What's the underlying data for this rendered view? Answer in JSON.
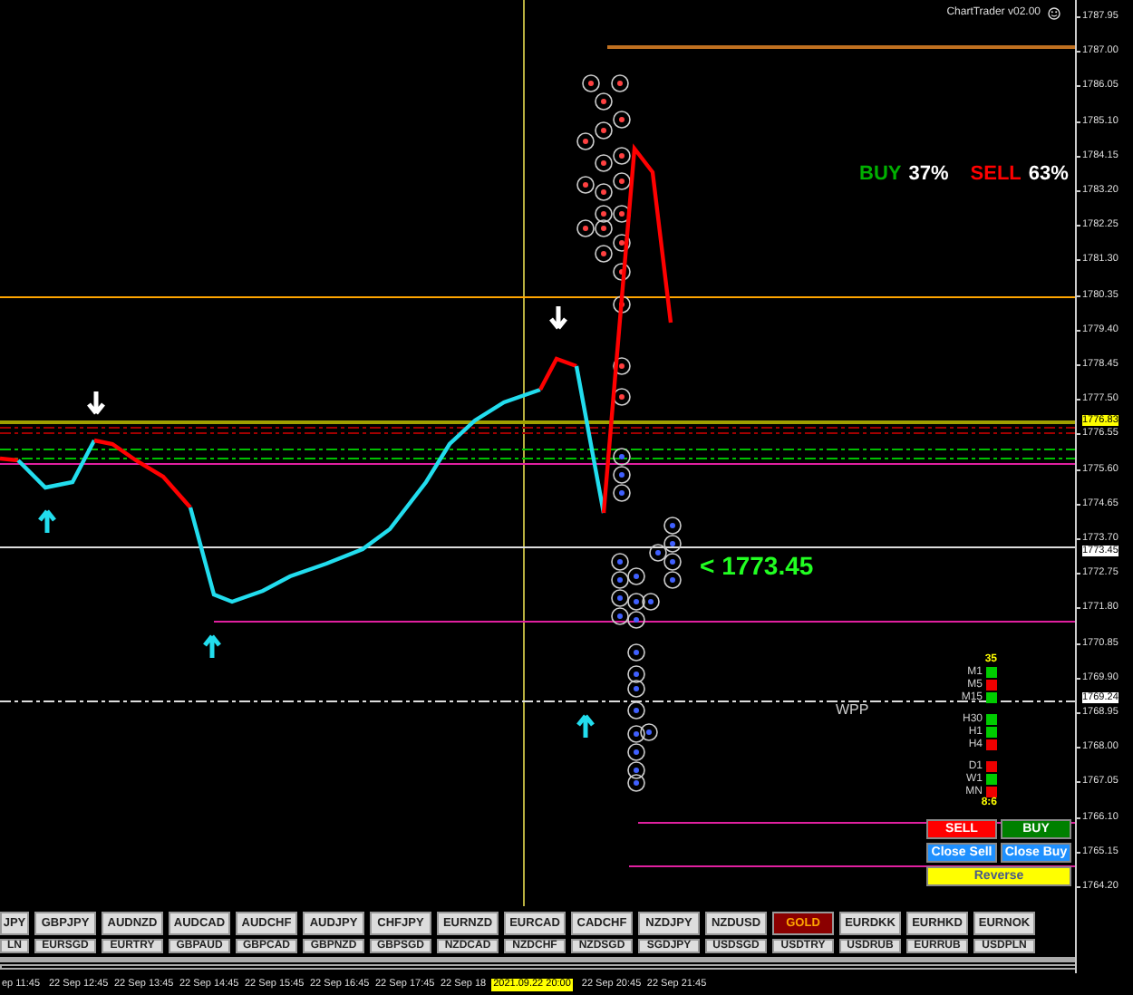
{
  "indicator_title": "ChartTrader v02.00",
  "sentiment": {
    "buy_label": "BUY",
    "buy_percent": "37%",
    "sell_label": "SELL",
    "sell_percent": "63%"
  },
  "price_marker": "< 1773.45",
  "pivot_label": "WPP",
  "timeframes": {
    "top_value": "35",
    "groups": [
      [
        {
          "label": "M1",
          "color": "#00cc00"
        },
        {
          "label": "M5",
          "color": "#ee0000"
        },
        {
          "label": "M15",
          "color": "#00cc00"
        }
      ],
      [
        {
          "label": "H30",
          "color": "#00cc00"
        },
        {
          "label": "H1",
          "color": "#00cc00"
        },
        {
          "label": "H4",
          "color": "#ee0000"
        }
      ],
      [
        {
          "label": "D1",
          "color": "#ee0000"
        },
        {
          "label": "W1",
          "color": "#00cc00"
        },
        {
          "label": "MN",
          "color": "#ee0000"
        }
      ]
    ],
    "bottom_value": "8:6"
  },
  "trade_buttons": [
    {
      "label": "SELL",
      "kind": "sell"
    },
    {
      "label": "BUY",
      "kind": "buy"
    },
    {
      "label": "Close Sell",
      "kind": "close"
    },
    {
      "label": "Close Buy",
      "kind": "close"
    },
    {
      "label": "Reverse",
      "kind": "reverse"
    }
  ],
  "symbol_rows": [
    [
      {
        "label": "JPY",
        "selected": false
      },
      {
        "label": "GBPJPY",
        "selected": false
      },
      {
        "label": "AUDNZD",
        "selected": false
      },
      {
        "label": "AUDCAD",
        "selected": false
      },
      {
        "label": "AUDCHF",
        "selected": false
      },
      {
        "label": "AUDJPY",
        "selected": false
      },
      {
        "label": "CHFJPY",
        "selected": false
      },
      {
        "label": "EURNZD",
        "selected": false
      },
      {
        "label": "EURCAD",
        "selected": false
      },
      {
        "label": "CADCHF",
        "selected": false
      },
      {
        "label": "NZDJPY",
        "selected": false
      },
      {
        "label": "NZDUSD",
        "selected": false
      },
      {
        "label": "GOLD",
        "selected": true
      },
      {
        "label": "EURDKK",
        "selected": false
      },
      {
        "label": "EURHKD",
        "selected": false
      },
      {
        "label": "EURNOK",
        "selected": false
      }
    ],
    [
      {
        "label": "LN",
        "selected": false
      },
      {
        "label": "EURSGD",
        "selected": false
      },
      {
        "label": "EURTRY",
        "selected": false
      },
      {
        "label": "GBPAUD",
        "selected": false
      },
      {
        "label": "GBPCAD",
        "selected": false
      },
      {
        "label": "GBPNZD",
        "selected": false
      },
      {
        "label": "GBPSGD",
        "selected": false
      },
      {
        "label": "NZDCAD",
        "selected": false
      },
      {
        "label": "NZDCHF",
        "selected": false
      },
      {
        "label": "NZDSGD",
        "selected": false
      },
      {
        "label": "SGDJPY",
        "selected": false
      },
      {
        "label": "USDSGD",
        "selected": false
      },
      {
        "label": "USDTRY",
        "selected": false
      },
      {
        "label": "USDRUB",
        "selected": false
      },
      {
        "label": "EURRUB",
        "selected": false
      },
      {
        "label": "USDPLN",
        "selected": false
      }
    ]
  ],
  "price_axis": [
    {
      "label": "1787.95",
      "kind": "tick"
    },
    {
      "label": "1787.00",
      "kind": "tick"
    },
    {
      "label": "1786.05",
      "kind": "tick"
    },
    {
      "label": "1785.10",
      "kind": "tick"
    },
    {
      "label": "1784.15",
      "kind": "tick"
    },
    {
      "label": "1783.20",
      "kind": "tick"
    },
    {
      "label": "1782.25",
      "kind": "tick"
    },
    {
      "label": "1781.30",
      "kind": "tick"
    },
    {
      "label": "1780.35",
      "kind": "tick"
    },
    {
      "label": "1779.40",
      "kind": "tick"
    },
    {
      "label": "1778.45",
      "kind": "tick"
    },
    {
      "label": "1777.50",
      "kind": "tick"
    },
    {
      "label": "1776.83",
      "kind": "bid"
    },
    {
      "label": "1776.55",
      "kind": "tick"
    },
    {
      "label": "1775.60",
      "kind": "tick"
    },
    {
      "label": "1774.65",
      "kind": "tick"
    },
    {
      "label": "1773.70",
      "kind": "tick"
    },
    {
      "label": "1773.45",
      "kind": "level"
    },
    {
      "label": "1772.75",
      "kind": "tick"
    },
    {
      "label": "1771.80",
      "kind": "tick"
    },
    {
      "label": "1770.85",
      "kind": "tick"
    },
    {
      "label": "1769.90",
      "kind": "tick"
    },
    {
      "label": "1769.24",
      "kind": "level"
    },
    {
      "label": "1768.95",
      "kind": "tick"
    },
    {
      "label": "1768.00",
      "kind": "tick"
    },
    {
      "label": "1767.05",
      "kind": "tick"
    },
    {
      "label": "1766.10",
      "kind": "tick"
    },
    {
      "label": "1765.15",
      "kind": "tick"
    },
    {
      "label": "1764.20",
      "kind": "tick"
    }
  ],
  "time_axis": [
    {
      "label": "ep 11:45",
      "kind": "start"
    },
    {
      "label": "22 Sep 12:45",
      "kind": "tick"
    },
    {
      "label": "22 Sep 13:45",
      "kind": "tick"
    },
    {
      "label": "22 Sep 14:45",
      "kind": "tick"
    },
    {
      "label": "22 Sep 15:45",
      "kind": "tick"
    },
    {
      "label": "22 Sep 16:45",
      "kind": "tick"
    },
    {
      "label": "22 Sep 17:45",
      "kind": "tick"
    },
    {
      "label": "22 Sep 18",
      "kind": "cut"
    },
    {
      "label": "2021.09.22 20:00",
      "kind": "cursor"
    },
    {
      "label": "22 Sep 20:45",
      "kind": "tick"
    },
    {
      "label": "22 Sep 21:45",
      "kind": "tick"
    }
  ]
}
